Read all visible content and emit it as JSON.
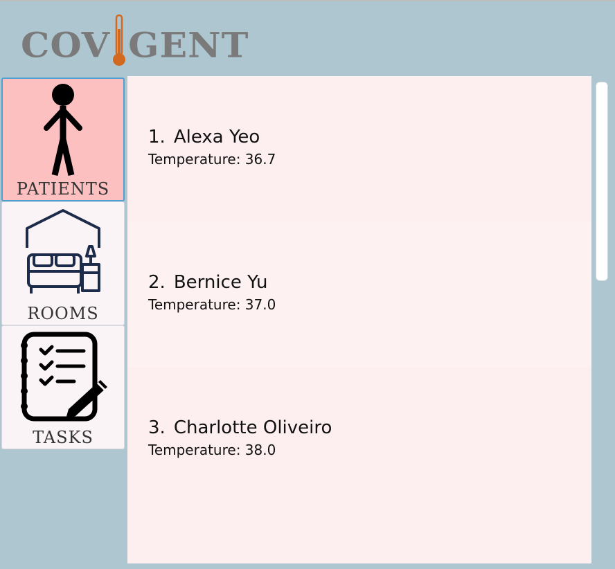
{
  "app": {
    "logo_left": "COV",
    "logo_right": "GENT"
  },
  "sidebar": {
    "items": [
      {
        "label": "PATIENTS",
        "icon": "person-icon",
        "active": true
      },
      {
        "label": "ROOMS",
        "icon": "bedroom-icon",
        "active": false
      },
      {
        "label": "TASKS",
        "icon": "checklist-icon",
        "active": false
      }
    ]
  },
  "patients": [
    {
      "index": "1.",
      "name": "Alexa Yeo",
      "temperature": "Temperature: 36.7"
    },
    {
      "index": "2.",
      "name": "Bernice Yu",
      "temperature": "Temperature: 37.0"
    },
    {
      "index": "3.",
      "name": "Charlotte Oliveiro",
      "temperature": "Temperature: 38.0"
    }
  ],
  "colors": {
    "background": "#adc6d0",
    "active_tab": "#fdc0c0",
    "active_border": "#4ea0d0",
    "list_background": "#fdeff0",
    "thermometer": "#d2691e"
  }
}
